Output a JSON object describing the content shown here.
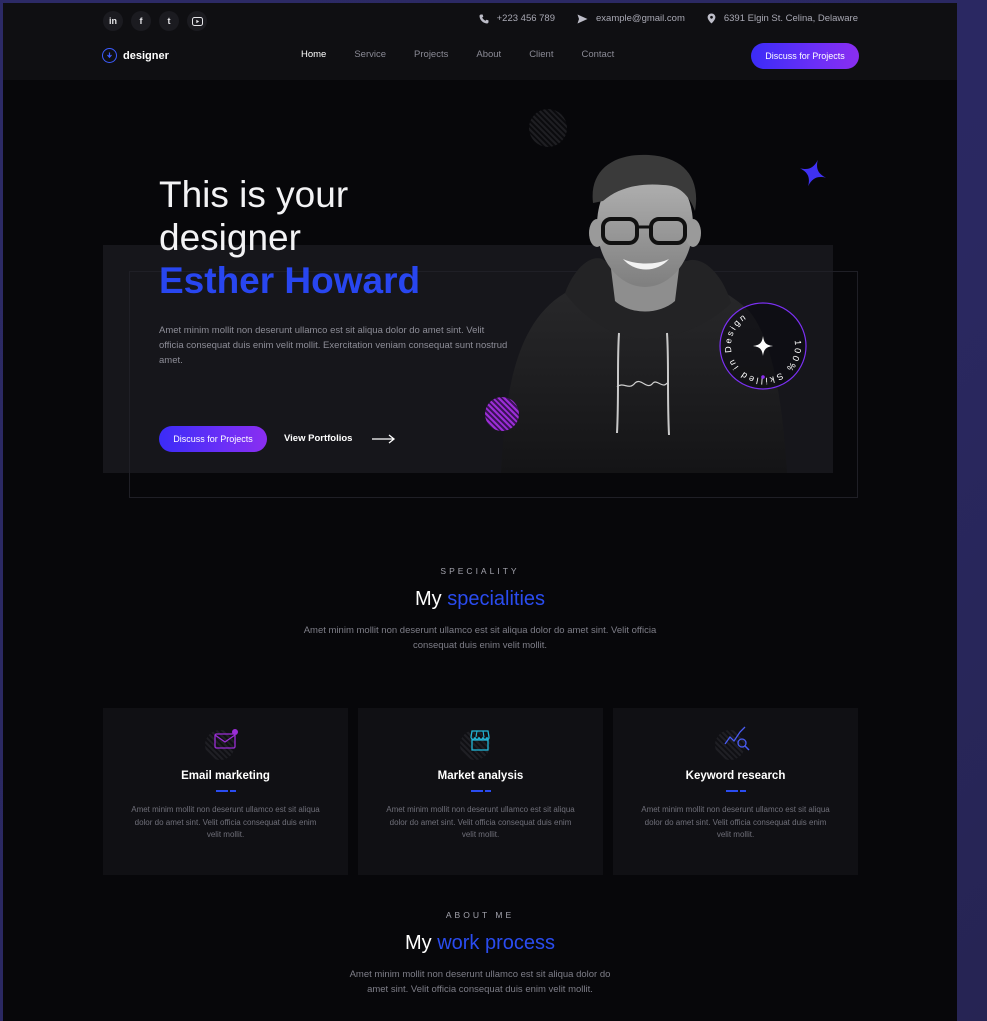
{
  "topbar": {
    "social": [
      {
        "icon": "linkedin-icon",
        "glyph": "in"
      },
      {
        "icon": "facebook-icon",
        "glyph": "f"
      },
      {
        "icon": "tumblr-icon",
        "glyph": "t"
      },
      {
        "icon": "youtube-icon",
        "glyph": "▶"
      }
    ],
    "phone": "+223 456 789",
    "email": "example@gmail.com",
    "address": "6391 Elgin St. Celina, Delaware"
  },
  "nav": {
    "logo": "designer",
    "items": [
      "Home",
      "Service",
      "Projects",
      "About",
      "Client",
      "Contact"
    ],
    "active": "Home",
    "cta": "Discuss for Projects"
  },
  "hero": {
    "line1": "This is your",
    "line2": "designer",
    "name": "Esther Howard",
    "description": "Amet minim mollit non deserunt ullamco est sit aliqua dolor do amet sint. Velit officia consequat duis enim velit mollit. Exercitation veniam consequat sunt nostrud amet.",
    "primary_button": "Discuss for Projects",
    "secondary_link": "View Portfolios",
    "badge_text": "100% Skilled in Design",
    "colors": {
      "accent": "#2846f0",
      "button_start": "#3b2cf7",
      "button_end": "#8a2ef0"
    }
  },
  "speciality": {
    "eyebrow": "SPECIALITY",
    "title_plain": "My",
    "title_accent": "specialities",
    "description": "Amet minim mollit non deserunt ullamco est sit aliqua dolor do amet sint. Velit officia consequat duis enim velit mollit.",
    "cards": [
      {
        "icon": "email-icon",
        "title": "Email marketing",
        "description": "Amet minim mollit non deserunt ullamco est sit aliqua dolor do amet sint. Velit officia consequat duis enim velit mollit."
      },
      {
        "icon": "storefront-icon",
        "title": "Market analysis",
        "description": "Amet minim mollit non deserunt ullamco est sit aliqua dolor do amet sint. Velit officia consequat duis enim velit mollit."
      },
      {
        "icon": "chart-search-icon",
        "title": "Keyword research",
        "description": "Amet minim mollit non deserunt ullamco est sit aliqua dolor do amet sint. Velit officia consequat duis enim velit mollit."
      }
    ]
  },
  "about": {
    "eyebrow": "ABOUT ME",
    "title_plain": "My",
    "title_accent": "work process",
    "description": "Amet minim mollit non deserunt ullamco est sit aliqua dolor do amet sint. Velit officia consequat duis enim velit mollit."
  }
}
